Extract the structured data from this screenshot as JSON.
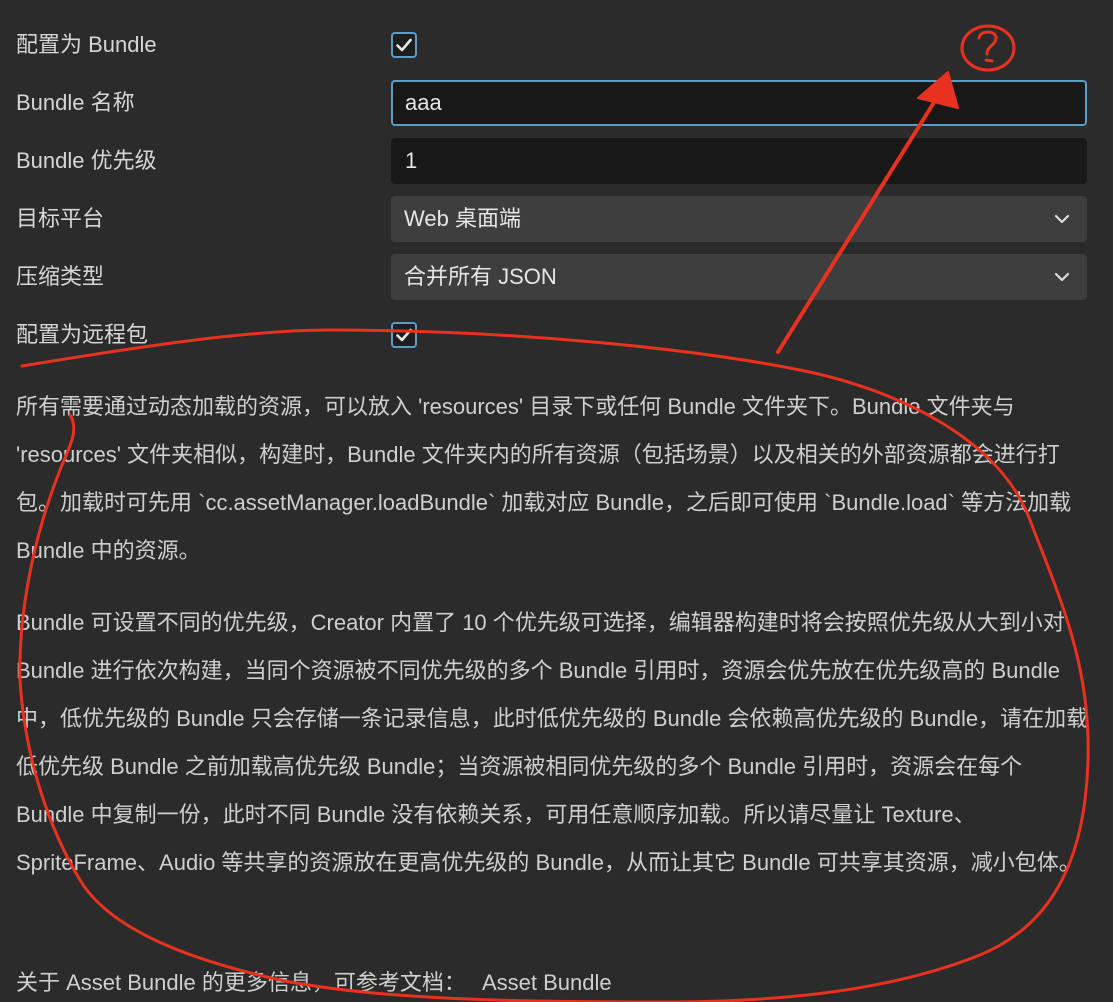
{
  "form": {
    "rows": [
      {
        "label": "配置为 Bundle",
        "checked": true
      },
      {
        "label": "Bundle 名称",
        "value": "aaa"
      },
      {
        "label": "Bundle 优先级",
        "value": "1"
      },
      {
        "label": "目标平台",
        "value": "Web 桌面端"
      },
      {
        "label": "压缩类型",
        "value": "合并所有 JSON"
      },
      {
        "label": "配置为远程包",
        "checked": true
      }
    ]
  },
  "description": {
    "p1": "所有需要通过动态加载的资源，可以放入 'resources' 目录下或任何 Bundle 文件夹下。Bundle 文件夹与 'resources' 文件夹相似，构建时，Bundle 文件夹内的所有资源（包括场景）以及相关的外部资源都会进行打包。加载时可先用 `cc.assetManager.loadBundle` 加载对应 Bundle，之后即可使用 `Bundle.load` 等方法加载 Bundle 中的资源。",
    "p2": "Bundle 可设置不同的优先级，Creator 内置了 10 个优先级可选择，编辑器构建时将会按照优先级从大到小对 Bundle 进行依次构建，当同个资源被不同优先级的多个 Bundle 引用时，资源会优先放在优先级高的 Bundle 中，低优先级的 Bundle 只会存储一条记录信息，此时低优先级的 Bundle 会依赖高优先级的 Bundle，请在加载低优先级 Bundle 之前加载高优先级 Bundle；当资源被相同优先级的多个 Bundle 引用时，资源会在每个 Bundle 中复制一份，此时不同 Bundle 没有依赖关系，可用任意顺序加载。所以请尽量让 Texture、SpriteFrame、Audio 等共享的资源放在更高优先级的 Bundle，从而让其它 Bundle 可共享其资源，减小包体。",
    "p3_prefix": "关于 Asset Bundle 的更多信息，可参考文档：",
    "p3_link": "Asset Bundle"
  },
  "annotation": {
    "color": "#e8321f",
    "question_mark": "?"
  },
  "colors": {
    "background": "#2b2b2b",
    "input_bg": "#181818",
    "select_bg": "#3e3e3e",
    "accent": "#5f9bc7"
  }
}
